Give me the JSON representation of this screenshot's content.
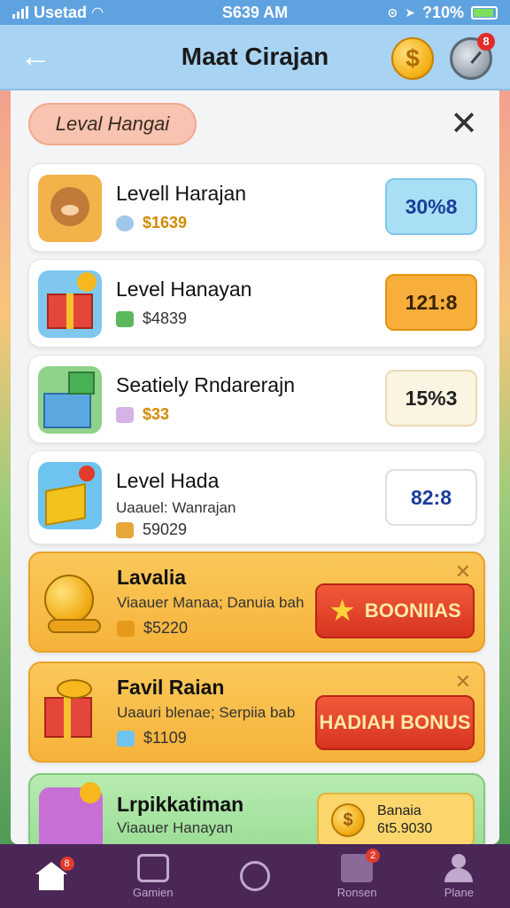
{
  "status_bar": {
    "carrier": "Usetad",
    "time": "S639 AM",
    "battery_text": "?10%"
  },
  "header": {
    "title": "Maat Cirajan",
    "coin_symbol": "$",
    "timer_badge": "8"
  },
  "level_pill": "Leval Hangai",
  "cards": [
    {
      "title": "Levell Harajan",
      "meta": "$1639",
      "value": "30%8",
      "thumb_color": "#f3b24a",
      "value_style": "blue"
    },
    {
      "title": "Level Hanayan",
      "meta": "$4839",
      "value": "121:8",
      "thumb_color": "#7fc7ee",
      "value_style": "orange"
    },
    {
      "title": "Seatiely Rndarerajn",
      "meta": "$33",
      "value": "15%3",
      "thumb_color": "#8fd28a",
      "value_style": "cream"
    },
    {
      "title": "Level Hada",
      "subtitle": "Uaauel: Wanrajan",
      "meta": "59029",
      "value": "82:8",
      "thumb_color": "#6fc3ef",
      "value_style": "white"
    }
  ],
  "bonus_cards": [
    {
      "title": "Lavalia",
      "subtitle": "Viaauer Manaa; Danuia bah",
      "meta": "$5220",
      "button": "BOONIIAS"
    },
    {
      "title": "Favil Raian",
      "subtitle": "Uaauri blenae; Serpiia bab",
      "meta": "$1109",
      "button": "HADIAH BONUS"
    }
  ],
  "green_card": {
    "title": "Lrpikkatiman",
    "subtitle": "Viaauer Hanayan",
    "button_line1": "Banaia",
    "button_line2": "6t5.9030"
  },
  "nav": [
    {
      "label": "",
      "badge": "8"
    },
    {
      "label": "Gamien",
      "badge": ""
    },
    {
      "label": "",
      "badge": ""
    },
    {
      "label": "Ronsen",
      "badge": "2"
    },
    {
      "label": "Plane",
      "badge": ""
    }
  ],
  "colors": {
    "status_bar": "#5fa2e0",
    "header": "#a8d3f3",
    "nav_bg": "#4a2757",
    "bonus_red": "#d7341f",
    "gold": "#f6b33a"
  }
}
